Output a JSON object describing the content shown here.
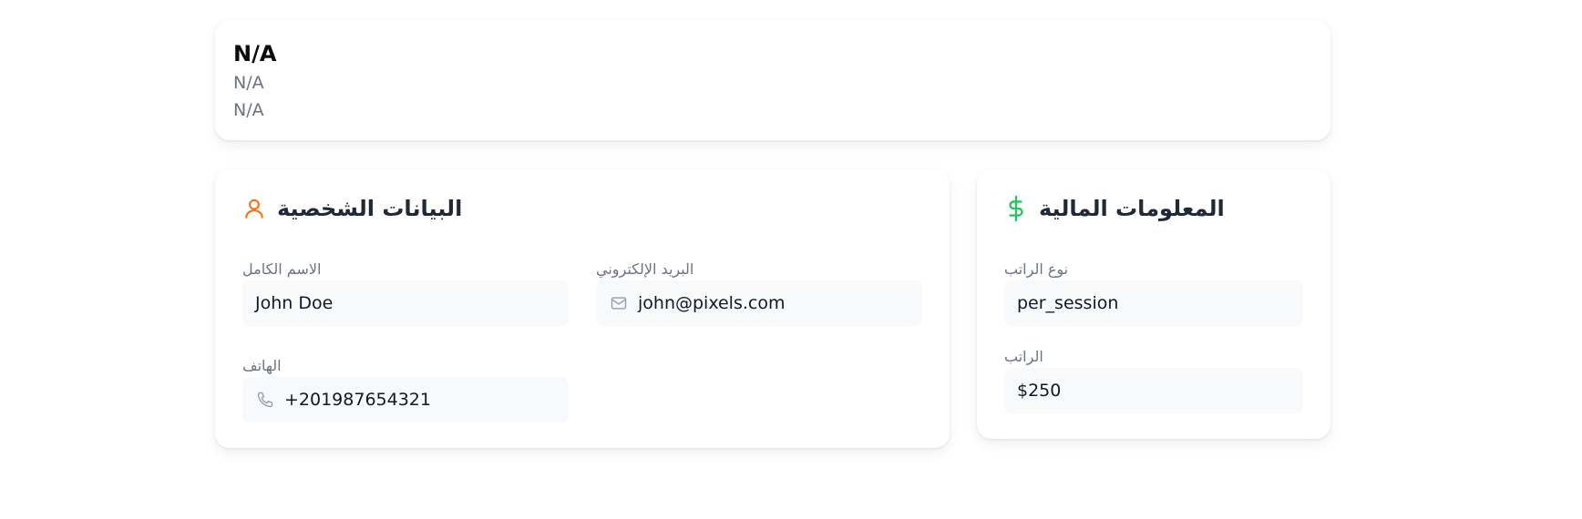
{
  "header": {
    "title": "N/A",
    "line1": "N/A",
    "line2": "N/A"
  },
  "personal": {
    "title": "البيانات الشخصية",
    "icon": "user-icon",
    "accent": "#f97316",
    "fields": {
      "full_name": {
        "label": "الاسم الكامل",
        "value": "John Doe"
      },
      "email": {
        "label": "البريد الإلكتروني",
        "value": "john@pixels.com",
        "icon": "mail-icon"
      },
      "phone": {
        "label": "الهاتف",
        "value": "+201987654321",
        "icon": "phone-icon"
      }
    }
  },
  "financial": {
    "title": "المعلومات المالية",
    "icon": "dollar-icon",
    "accent": "#22c55e",
    "fields": {
      "salary_type": {
        "label": "نوع الراتب",
        "value": "per_session"
      },
      "salary": {
        "label": "الراتب",
        "value": "$250"
      }
    }
  }
}
